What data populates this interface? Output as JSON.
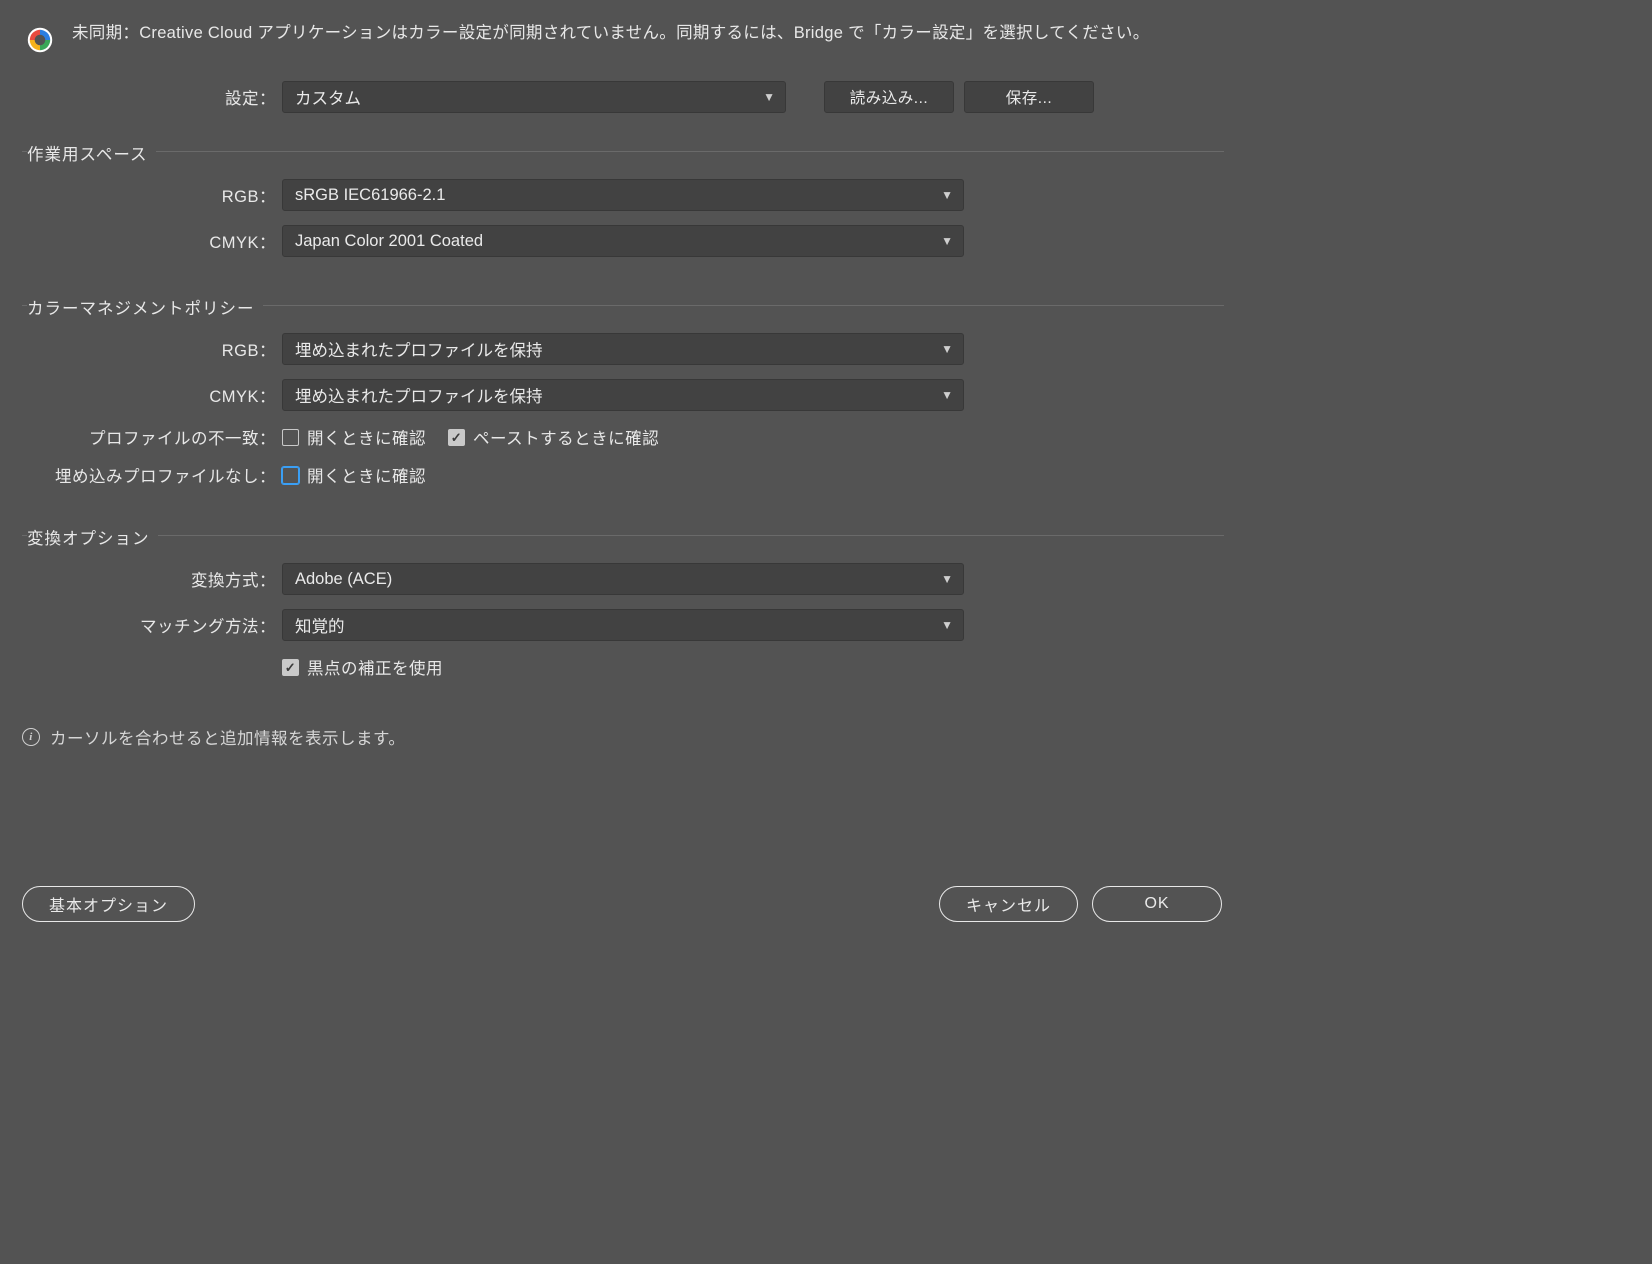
{
  "header": {
    "message": "未同期：Creative Cloud アプリケーションはカラー設定が同期されていません。同期するには、Bridge で「カラー設定」を選択してください。"
  },
  "settings_row": {
    "label": "設定：",
    "value": "カスタム",
    "load_btn": "読み込み...",
    "save_btn": "保存..."
  },
  "group_workspace": {
    "title": "作業用スペース",
    "rgb_label": "RGB：",
    "rgb_value": "sRGB IEC61966-2.1",
    "cmyk_label": "CMYK：",
    "cmyk_value": "Japan Color 2001 Coated"
  },
  "group_policy": {
    "title": "カラーマネジメントポリシー",
    "rgb_label": "RGB：",
    "rgb_value": "埋め込まれたプロファイルを保持",
    "cmyk_label": "CMYK：",
    "cmyk_value": "埋め込まれたプロファイルを保持",
    "mismatch_label": "プロファイルの不一致：",
    "mismatch_open": "開くときに確認",
    "mismatch_paste": "ペーストするときに確認",
    "missing_label": "埋め込みプロファイルなし：",
    "missing_open": "開くときに確認"
  },
  "group_convert": {
    "title": "変換オプション",
    "engine_label": "変換方式：",
    "engine_value": "Adobe (ACE)",
    "intent_label": "マッチング方法：",
    "intent_value": "知覚的",
    "blackpoint": "黒点の補正を使用"
  },
  "info": {
    "text": "カーソルを合わせると追加情報を表示します。"
  },
  "footer": {
    "basic": "基本オプション",
    "cancel": "キャンセル",
    "ok": "OK"
  }
}
